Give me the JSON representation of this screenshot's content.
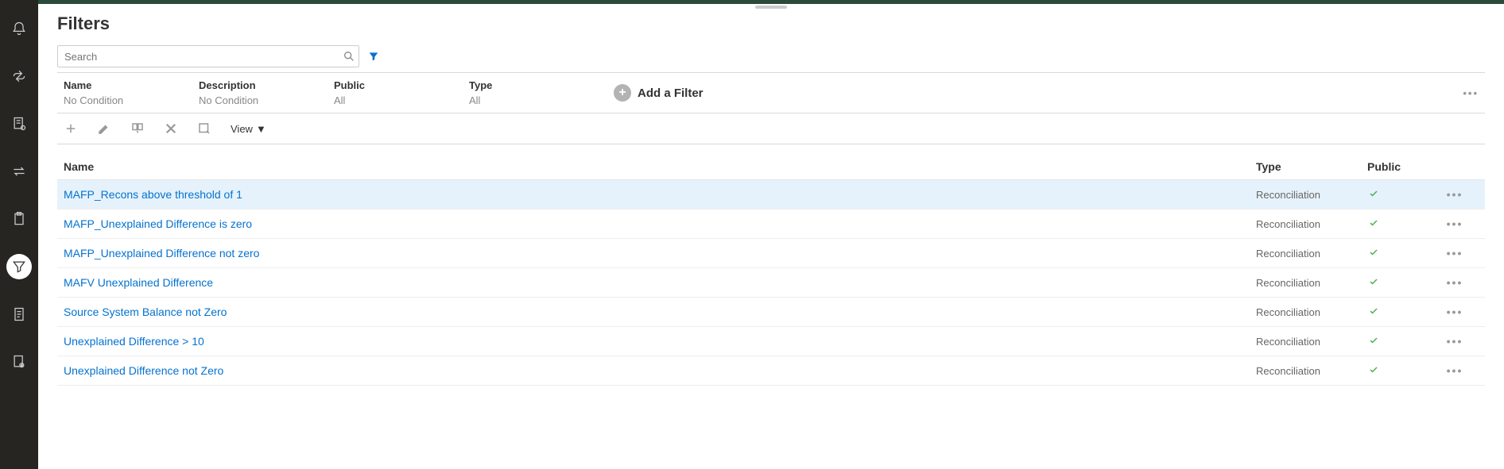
{
  "page": {
    "title": "Filters"
  },
  "search": {
    "placeholder": "Search"
  },
  "filterbar": {
    "columns": [
      {
        "label": "Name",
        "value": "No Condition"
      },
      {
        "label": "Description",
        "value": "No Condition"
      },
      {
        "label": "Public",
        "value": "All"
      },
      {
        "label": "Type",
        "value": "All"
      }
    ],
    "add_label": "Add a Filter"
  },
  "toolbar": {
    "view_label": "View"
  },
  "table": {
    "headers": {
      "name": "Name",
      "type": "Type",
      "public": "Public"
    },
    "rows": [
      {
        "name": "MAFP_Recons above threshold of 1",
        "type": "Reconciliation",
        "public": true,
        "selected": true
      },
      {
        "name": "MAFP_Unexplained Difference is zero",
        "type": "Reconciliation",
        "public": true,
        "selected": false
      },
      {
        "name": "MAFP_Unexplained Difference not zero",
        "type": "Reconciliation",
        "public": true,
        "selected": false
      },
      {
        "name": "MAFV Unexplained Difference",
        "type": "Reconciliation",
        "public": true,
        "selected": false
      },
      {
        "name": "Source System Balance not Zero",
        "type": "Reconciliation",
        "public": true,
        "selected": false
      },
      {
        "name": "Unexplained Difference > 10",
        "type": "Reconciliation",
        "public": true,
        "selected": false
      },
      {
        "name": "Unexplained Difference not Zero",
        "type": "Reconciliation",
        "public": true,
        "selected": false
      }
    ]
  },
  "sidebar": {
    "items": [
      {
        "name": "notifications"
      },
      {
        "name": "refresh"
      },
      {
        "name": "settings-doc"
      },
      {
        "name": "transfer"
      },
      {
        "name": "clipboard"
      },
      {
        "name": "filters",
        "active": true
      },
      {
        "name": "document"
      },
      {
        "name": "preview"
      }
    ]
  }
}
